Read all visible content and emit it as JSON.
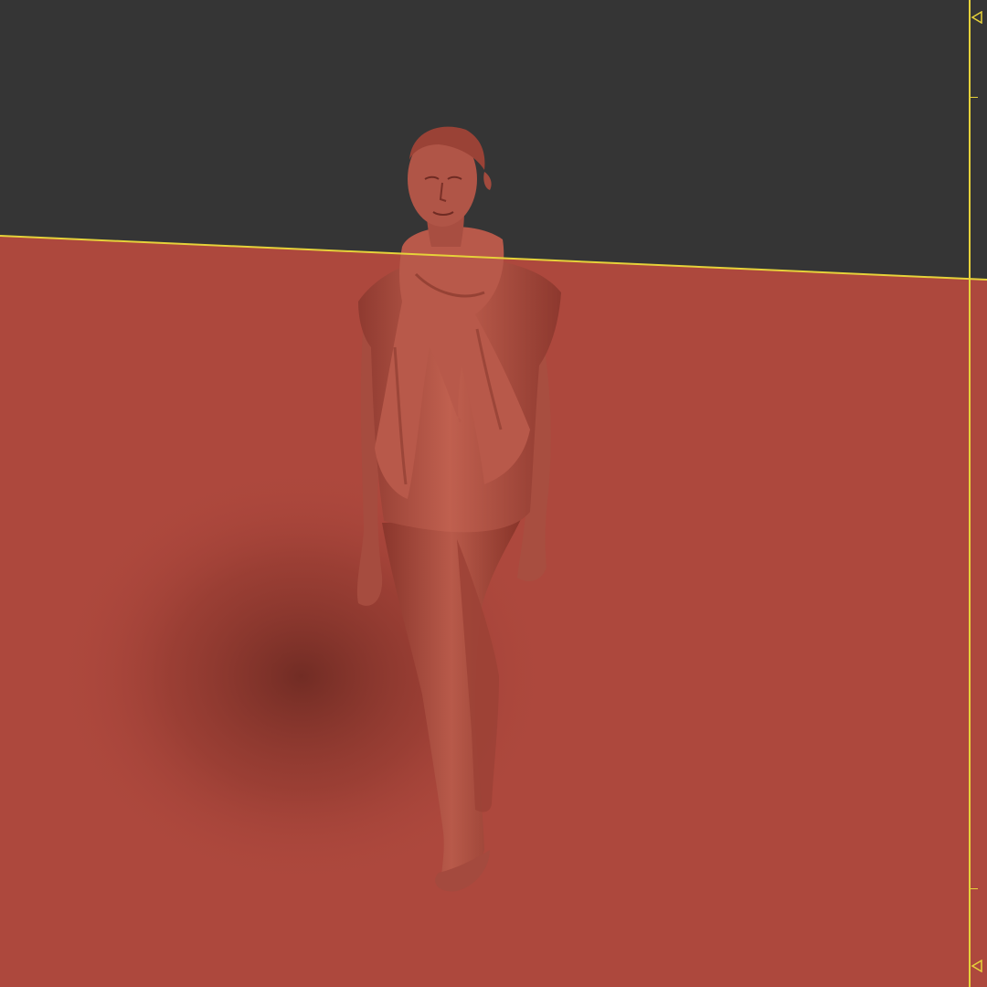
{
  "viewport": {
    "background_color": "#353535",
    "ground_color": "#ad483d",
    "horizon_color": "#e6d23a",
    "model_color": "#b5564a",
    "shadow_color": "#6e2a22"
  },
  "ruler": {
    "color": "#e6d23a",
    "markers": [
      "marker-top",
      "marker-bottom"
    ]
  },
  "icons": {
    "top_marker": "triangle-left-icon",
    "bottom_marker": "triangle-left-icon"
  }
}
